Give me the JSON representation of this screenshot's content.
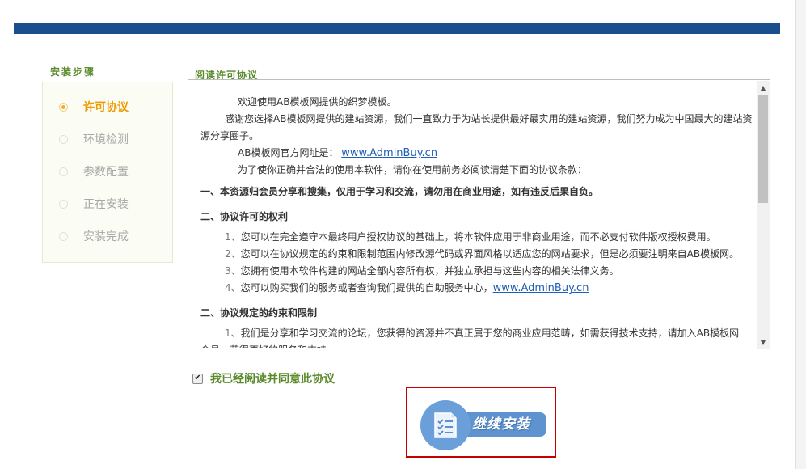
{
  "sidebar": {
    "title": "安装步骤",
    "steps": [
      {
        "label": "许可协议",
        "active": true
      },
      {
        "label": "环境检测",
        "active": false
      },
      {
        "label": "参数配置",
        "active": false
      },
      {
        "label": "正在安装",
        "active": false
      },
      {
        "label": "安装完成",
        "active": false
      }
    ]
  },
  "panel": {
    "title": "阅读许可协议",
    "welcome": "欢迎使用AB模板网提供的织梦模板。",
    "thanks": "感谢您选择AB模板网提供的建站资源，我们一直致力于为站长提供最好最实用的建站资源，我们努力成为中国最大的建站资源分享圈子。",
    "site_label": "AB模板网官方网址是：",
    "site_link": "www.AdminBuy.cn",
    "read_notice": "为了使你正确并合法的使用本软件，请你在使用前务必阅读清楚下面的协议条款：",
    "section1": "一、本资源归会员分享和搜集，仅用于学习和交流，请勿用在商业用途，如有违反后果自负。",
    "section2": "二、协议许可的权利",
    "rights": [
      {
        "num": "1、",
        "text": "您可以在完全遵守本最终用户授权协议的基础上，将本软件应用于非商业用途，而不必支付软件版权授权费用。"
      },
      {
        "num": "2、",
        "text": "您可以在协议规定的约束和限制范围内修改源代码或界面风格以适应您的网站要求，但是必须要注明来自AB模板网。"
      },
      {
        "num": "3、",
        "text": "您拥有使用本软件构建的网站全部内容所有权，并独立承担与这些内容的相关法律义务。"
      },
      {
        "num": "4、",
        "text": "您可以购买我们的服务或者查询我们提供的自助服务中心，",
        "link": "www.AdminBuy.cn"
      }
    ],
    "section3": "二、协议规定的约束和限制",
    "limits": [
      {
        "num": "1、",
        "text": "我们是分享和学习交流的论坛，您获得的资源并不真正属于您的商业应用范畴，如需获得技术支持，请加入AB模板网会员，获得更好的服务和支持。"
      }
    ]
  },
  "agree": {
    "label": "我已经阅读并同意此协议",
    "checked": true
  },
  "install_button": {
    "label": "继续安装"
  },
  "colors": {
    "accent_green": "#5a8a2a",
    "active_orange": "#ee9a00",
    "top_bar": "#1b4e8c",
    "button_blue": "#5f93cf",
    "highlight_red": "#c80000"
  }
}
